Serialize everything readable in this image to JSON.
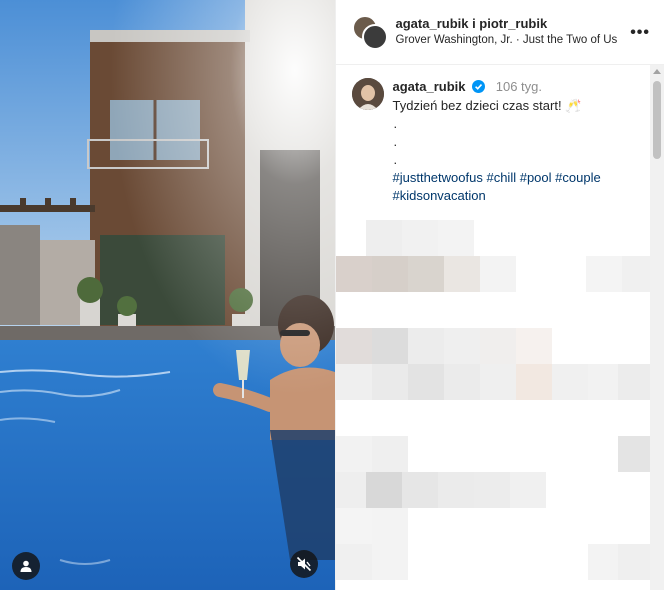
{
  "header": {
    "names": "agata_rubik i piotr_rubik",
    "music": "Grover Washington, Jr. · Just the Two of Us"
  },
  "caption": {
    "username": "agata_rubik",
    "age": "106 tyg.",
    "text": "Tydzień bez dzieci czas start! 🥂",
    "dots": [
      ".",
      ".",
      "."
    ],
    "hashtags": [
      "#justthetwoofus",
      "#chill",
      "#pool",
      "#couple",
      "#kidsonvacation"
    ]
  },
  "icons": {
    "verified": "verified-badge-icon",
    "more": "more-options-icon",
    "user_tag": "user-tag-icon",
    "mute": "sound-off-icon"
  },
  "colors": {
    "hashtag": "#00376b",
    "verified": "#0095f6",
    "muted_text": "#8e8e8e"
  }
}
